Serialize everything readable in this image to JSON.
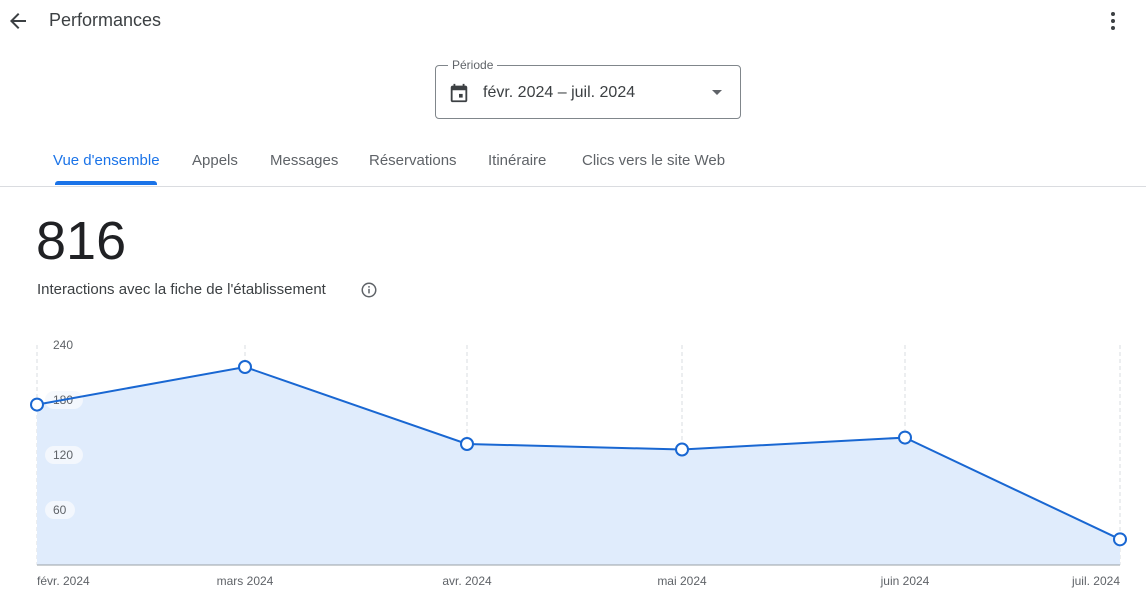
{
  "header": {
    "title": "Performances",
    "back_icon": "arrow-back-icon",
    "more_icon": "more-vert-icon"
  },
  "period": {
    "label": "Période",
    "value": "févr. 2024 – juil. 2024",
    "icon": "calendar-icon"
  },
  "tabs": [
    {
      "label": "Vue d'ensemble",
      "active": true
    },
    {
      "label": "Appels",
      "active": false
    },
    {
      "label": "Messages",
      "active": false
    },
    {
      "label": "Réservations",
      "active": false
    },
    {
      "label": "Itinéraire",
      "active": false
    },
    {
      "label": "Clics vers le site Web",
      "active": false
    }
  ],
  "summary": {
    "total": "816",
    "label": "Interactions avec la fiche de l'établissement"
  },
  "colors": {
    "accent": "#1a73e8",
    "line": "#1967d2",
    "area": "#e0ecfc"
  },
  "chart_data": {
    "type": "area",
    "title": "",
    "xlabel": "",
    "ylabel": "",
    "categories": [
      "févr. 2024",
      "mars 2024",
      "avr. 2024",
      "mai 2024",
      "juin 2024",
      "juil. 2024"
    ],
    "series": [
      {
        "name": "Interactions avec la fiche de l'établissement",
        "values": [
          175,
          216,
          132,
          126,
          139,
          28
        ]
      }
    ],
    "yticks": [
      60,
      120,
      180,
      240
    ],
    "ytick_labels": [
      "60",
      "120",
      "180",
      "240"
    ],
    "ylim": [
      0,
      240
    ],
    "grid": "vertical dashed",
    "legend": "none"
  }
}
